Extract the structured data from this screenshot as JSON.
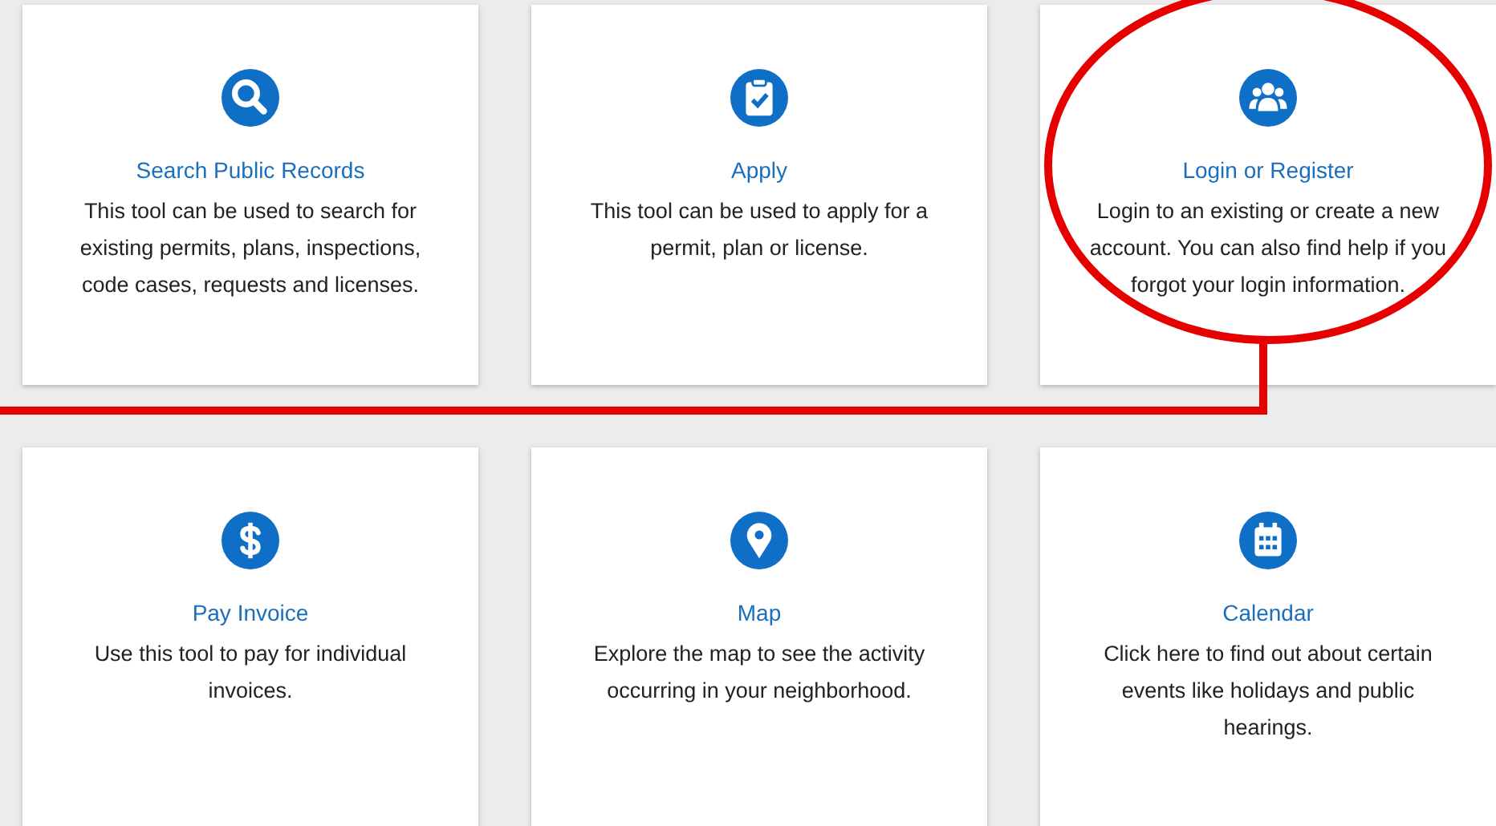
{
  "cards": [
    {
      "kind": "search",
      "title": "Search Public Records",
      "description": "This tool can be used to search for existing permits, plans, inspections, code cases, requests and licenses.",
      "circled": false
    },
    {
      "kind": "apply",
      "title": "Apply",
      "description": "This tool can be used to apply for a permit, plan or license.",
      "circled": false
    },
    {
      "kind": "account",
      "title": "Login or Register",
      "description": "Login to an existing or create a new account. You can also find help if you forgot your login information.",
      "circled": true
    },
    {
      "kind": "payment",
      "title": "Pay Invoice",
      "description": "Use this tool to pay for individual invoices.",
      "circled": false
    },
    {
      "kind": "map",
      "title": "Map",
      "description": "Explore the map to see the activity occurring in your neighborhood.",
      "circled": false
    },
    {
      "kind": "calendar",
      "title": "Calendar",
      "description": "Click here to find out about certain events like holidays and public hearings.",
      "circled": false
    }
  ]
}
